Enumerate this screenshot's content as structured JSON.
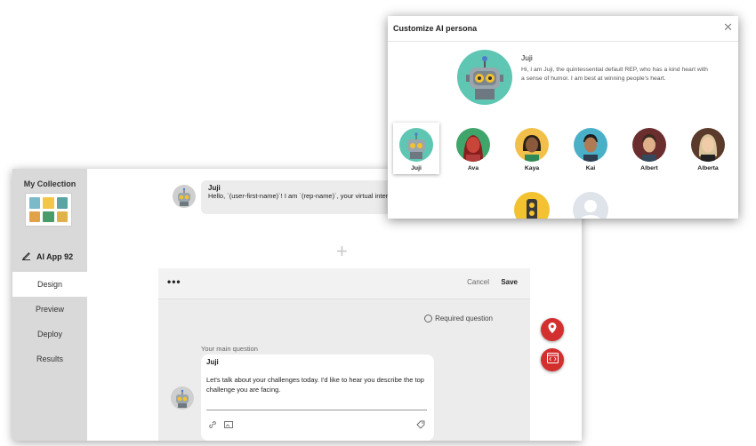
{
  "sidebar": {
    "collection_title": "My Collection",
    "app_name": "AI App 92",
    "nav": [
      {
        "label": "Design",
        "active": true
      },
      {
        "label": "Preview",
        "active": false
      },
      {
        "label": "Deploy",
        "active": false
      },
      {
        "label": "Results",
        "active": false
      }
    ]
  },
  "chat": {
    "sender": "Juji",
    "message": "Hello, `(user-first-name)`! I am `(rep-name)`, your virtual interviewer."
  },
  "editor": {
    "more_icon": "more-icon",
    "more_label": "•••",
    "cancel_label": "Cancel",
    "save_label": "Save",
    "required_label": "Required question",
    "main_question_label": "Your main question",
    "question_sender": "Juji",
    "question_text": "Let's talk about your challenges today. I'd like to hear you describe the top challenge you are facing."
  },
  "modal": {
    "title": "Customize AI persona",
    "close_label": "✕",
    "selected_name": "Juji",
    "selected_desc": "Hi, I am Juji, the quintessential default REP, who has a kind heart with a sense of humor. I am best at winning people's heart.",
    "personas": [
      {
        "name": "Juji",
        "selected": true
      },
      {
        "name": "Ava",
        "selected": false
      },
      {
        "name": "Kaya",
        "selected": false
      },
      {
        "name": "Kai",
        "selected": false
      },
      {
        "name": "Albert",
        "selected": false
      },
      {
        "name": "Alberta",
        "selected": false
      }
    ]
  },
  "colors": {
    "accent_red": "#d32f2f",
    "robot_teal": "#5ec6b3"
  }
}
